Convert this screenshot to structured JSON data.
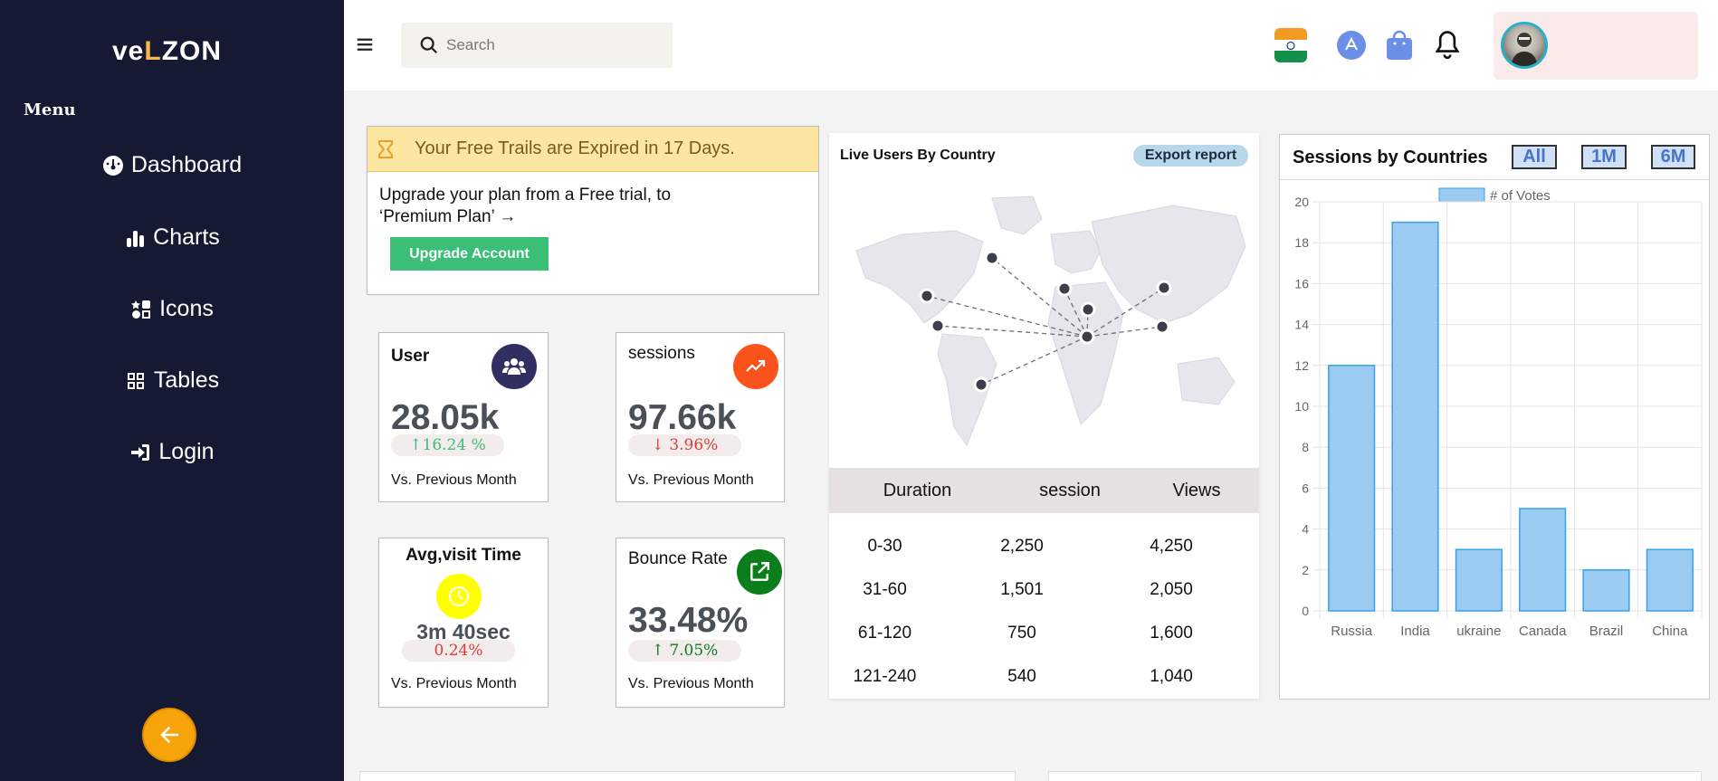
{
  "sidebar": {
    "logo_main": "veLZon",
    "menu_title": "Menu",
    "items": [
      {
        "label": "Dashboard",
        "icon": "dashboard-icon"
      },
      {
        "label": "Charts",
        "icon": "bar-chart-icon"
      },
      {
        "label": "Icons",
        "icon": "icons-icon"
      },
      {
        "label": "Tables",
        "icon": "grid-icon"
      },
      {
        "label": "Login",
        "icon": "login-icon"
      }
    ]
  },
  "header": {
    "search_placeholder": "Search"
  },
  "trial": {
    "banner": "Your Free Trails are Expired in 17 Days.",
    "line1": "Upgrade your plan from a Free trial, to",
    "line2": "‘Premium Plan’",
    "button": "Upgrade Account"
  },
  "stats": [
    {
      "label": "User",
      "value": "28.05k",
      "change": "16.24 %",
      "direction": "up",
      "footer": "Vs. Previous Month",
      "color": "#2f3061"
    },
    {
      "label": "sessions",
      "value": "97.66k",
      "change": "3.96%",
      "direction": "down",
      "footer": "Vs. Previous Month",
      "color": "#fa541c"
    },
    {
      "label": "Avg,visit Time",
      "value": "3m 40sec",
      "change": "0.24%",
      "direction": "down",
      "footer": "Vs. Previous Month",
      "color": "#ffff00"
    },
    {
      "label": "Bounce Rate",
      "value": "33.48%",
      "change": "7.05%",
      "direction": "up",
      "footer": "Vs. Previous Month",
      "color": "#0c7d1b"
    }
  ],
  "live": {
    "title": "Live Users By Country",
    "export": "Export report",
    "columns": [
      "Duration",
      "session",
      "Views"
    ],
    "rows": [
      [
        "0-30",
        "2,250",
        "4,250"
      ],
      [
        "31-60",
        "1,501",
        "2,050"
      ],
      [
        "61-120",
        "750",
        "1,600"
      ],
      [
        "121-240",
        "540",
        "1,040"
      ]
    ]
  },
  "sessions": {
    "title": "Sessions by Countries",
    "tabs": [
      "All",
      "1M",
      "6M"
    ]
  },
  "chart_data": {
    "type": "bar",
    "categories": [
      "Russia",
      "India",
      "ukraine",
      "Canada",
      "Brazil",
      "China"
    ],
    "series": [
      {
        "name": "# of Votes",
        "values": [
          12,
          19,
          3,
          5,
          2,
          3
        ]
      }
    ],
    "ylim": [
      0,
      20
    ],
    "yticks": [
      0,
      2,
      4,
      6,
      8,
      10,
      12,
      14,
      16,
      18,
      20
    ],
    "legend": "top",
    "grid": true,
    "bar_color": "#9ccbf2",
    "bar_border": "#36a2eb"
  }
}
